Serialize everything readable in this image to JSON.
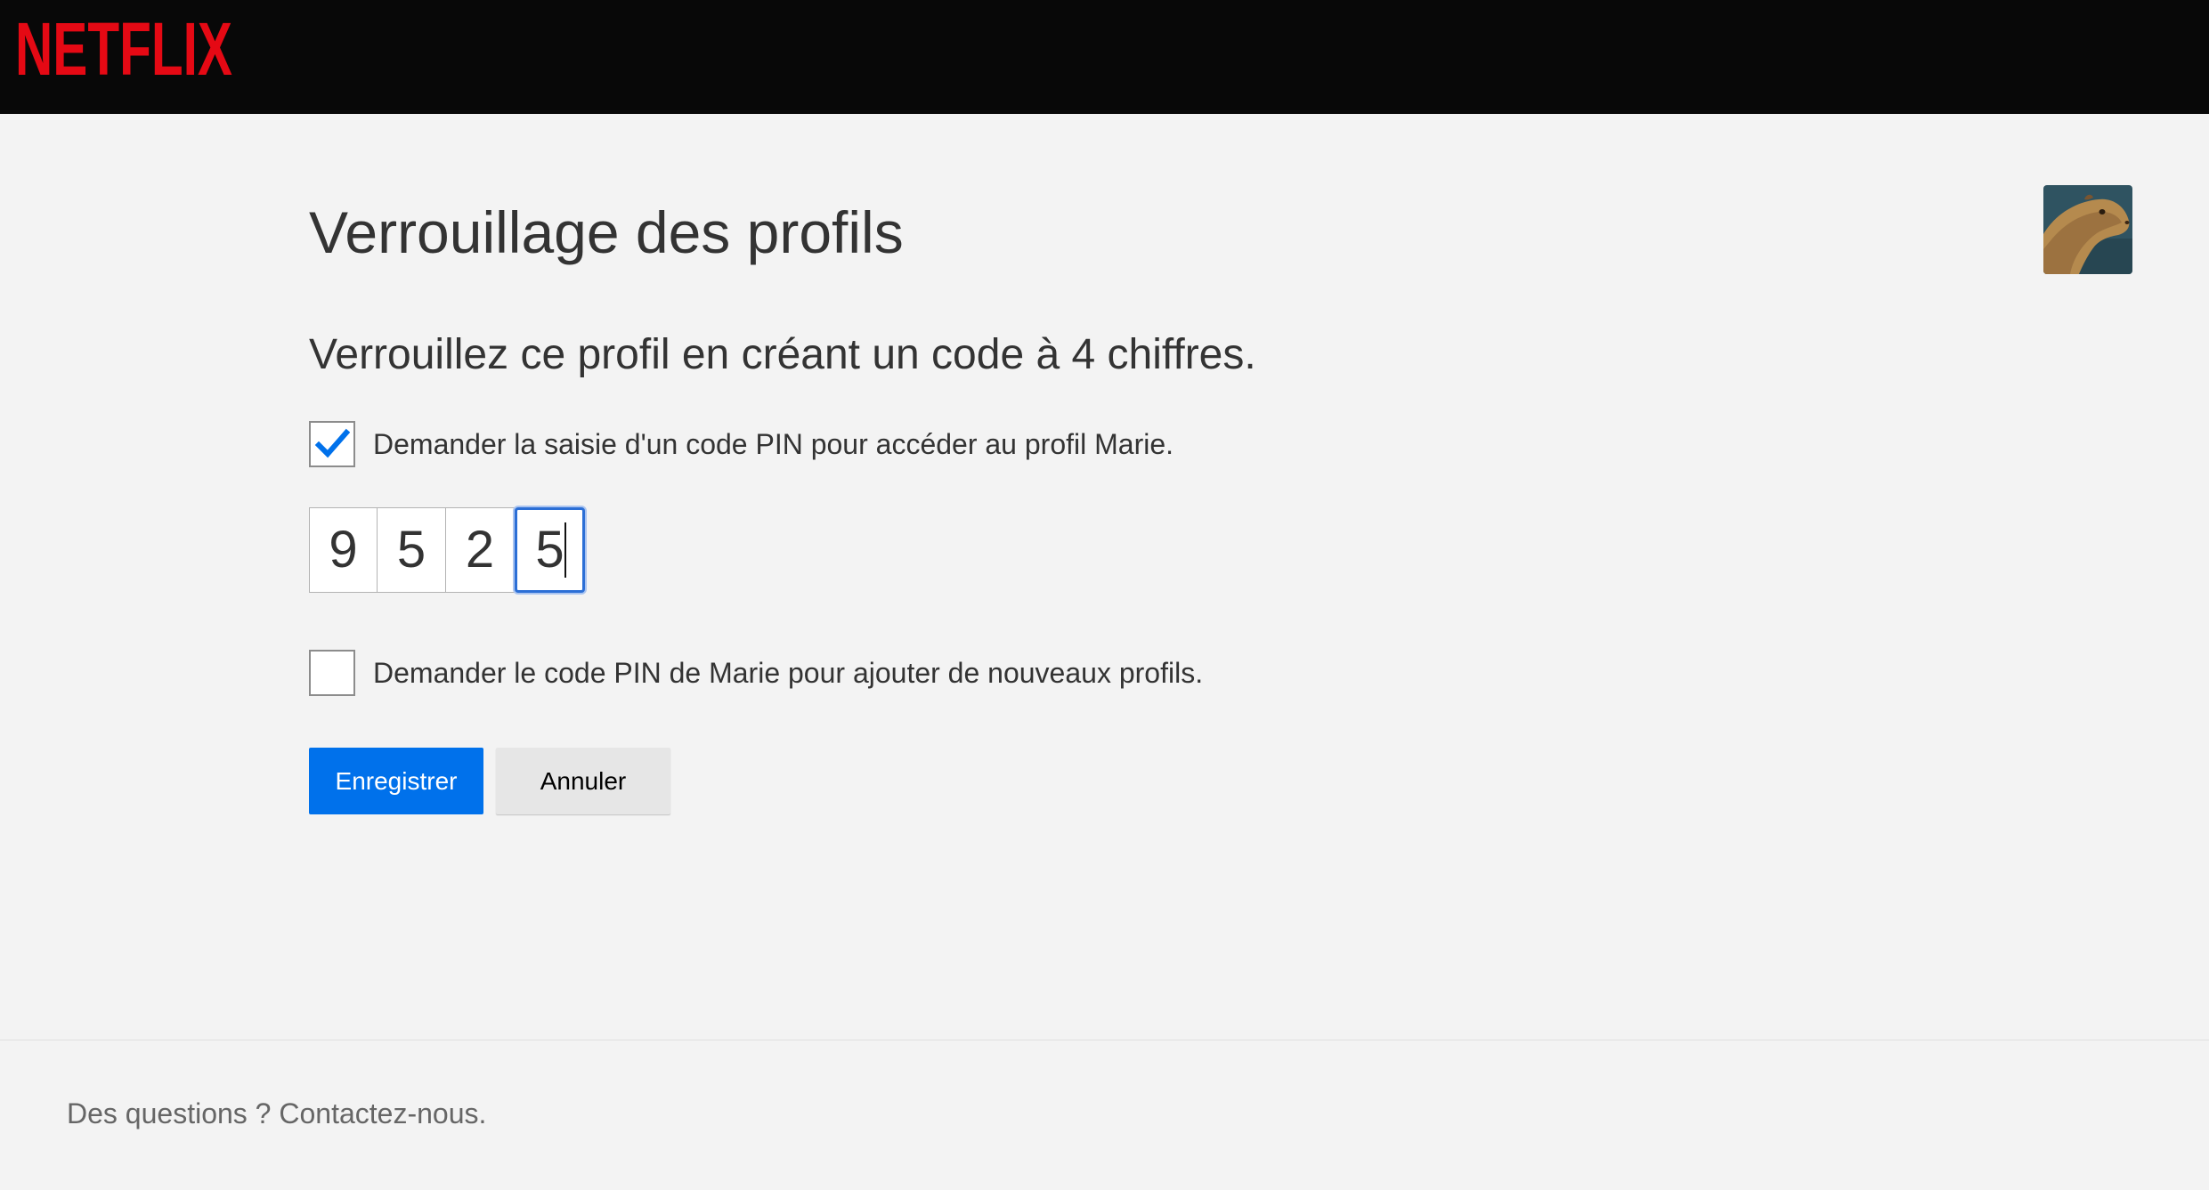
{
  "header": {
    "logo_text": "NETFLIX",
    "logo_color": "#e50914"
  },
  "profile": {
    "avatar_icon": "capybara-avatar"
  },
  "main": {
    "title": "Verrouillage des profils",
    "subtitle": "Verrouillez ce profil en créant un code à 4 chiffres.",
    "require_pin_checkbox": {
      "label": "Demander la saisie d'un code PIN pour accéder au profil Marie.",
      "checked": true
    },
    "pin": {
      "digits": [
        "9",
        "5",
        "2",
        "5"
      ]
    },
    "require_pin_new_profiles_checkbox": {
      "label": "Demander le code PIN de Marie pour ajouter de nouveaux profils.",
      "checked": false
    },
    "save_label": "Enregistrer",
    "cancel_label": "Annuler"
  },
  "footer": {
    "contact_text": "Des questions ? Contactez-nous."
  },
  "colors": {
    "primary_button": "#0071eb",
    "checkmark": "#0071eb",
    "focus_ring": "#2c6fd6"
  }
}
